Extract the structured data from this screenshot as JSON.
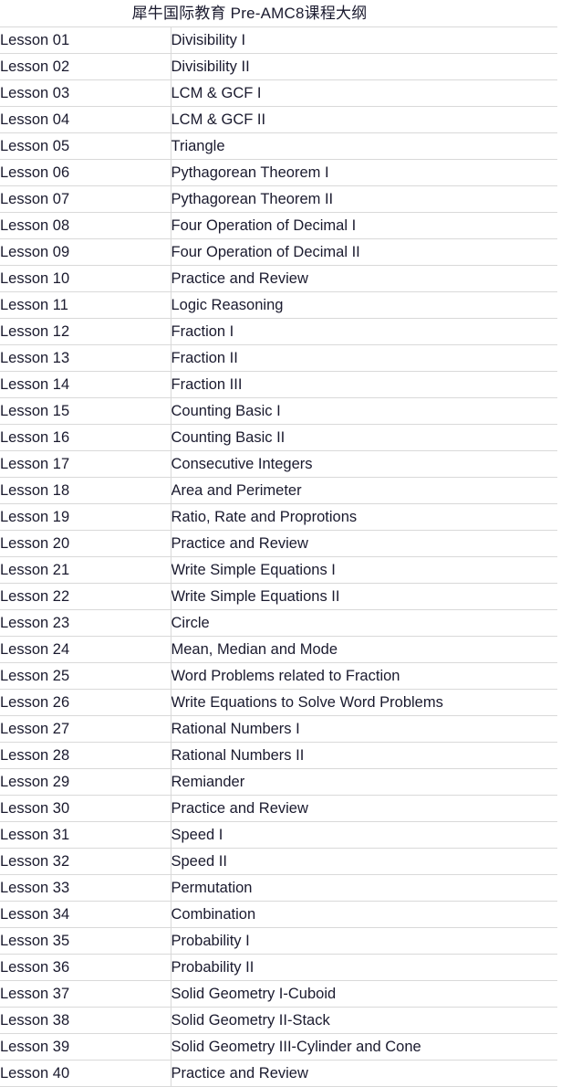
{
  "document": {
    "title": "犀牛国际教育 Pre-AMC8课程大纲",
    "border_color": "#d9d9d9",
    "text_color": "#1a1a2e",
    "background_color": "#ffffff"
  },
  "table": {
    "columns": [
      "lesson",
      "topic"
    ],
    "rows": [
      {
        "lesson": "Lesson 01",
        "topic": "Divisibility I"
      },
      {
        "lesson": "Lesson 02",
        "topic": "Divisibility II"
      },
      {
        "lesson": "Lesson 03",
        "topic": "LCM & GCF I"
      },
      {
        "lesson": "Lesson 04",
        "topic": "LCM & GCF II"
      },
      {
        "lesson": "Lesson 05",
        "topic": "Triangle"
      },
      {
        "lesson": "Lesson 06",
        "topic": "Pythagorean Theorem I"
      },
      {
        "lesson": "Lesson 07",
        "topic": "Pythagorean Theorem II"
      },
      {
        "lesson": "Lesson 08",
        "topic": "Four Operation of Decimal I"
      },
      {
        "lesson": "Lesson 09",
        "topic": "Four Operation of Decimal II"
      },
      {
        "lesson": "Lesson 10",
        "topic": "Practice and Review"
      },
      {
        "lesson": "Lesson 11",
        "topic": "Logic Reasoning"
      },
      {
        "lesson": "Lesson 12",
        "topic": "Fraction I"
      },
      {
        "lesson": "Lesson 13",
        "topic": "Fraction II"
      },
      {
        "lesson": "Lesson 14",
        "topic": "Fraction III"
      },
      {
        "lesson": "Lesson 15",
        "topic": "Counting Basic I"
      },
      {
        "lesson": "Lesson 16",
        "topic": "Counting Basic II"
      },
      {
        "lesson": "Lesson 17",
        "topic": "Consecutive Integers"
      },
      {
        "lesson": "Lesson 18",
        "topic": "Area and Perimeter"
      },
      {
        "lesson": "Lesson 19",
        "topic": "Ratio, Rate and Proprotions"
      },
      {
        "lesson": "Lesson 20",
        "topic": "Practice and Review"
      },
      {
        "lesson": "Lesson 21",
        "topic": "Write Simple Equations I"
      },
      {
        "lesson": "Lesson 22",
        "topic": "Write Simple Equations II"
      },
      {
        "lesson": "Lesson 23",
        "topic": "Circle"
      },
      {
        "lesson": "Lesson 24",
        "topic": "Mean, Median and Mode"
      },
      {
        "lesson": "Lesson 25",
        "topic": "Word Problems related to Fraction"
      },
      {
        "lesson": "Lesson 26",
        "topic": "Write Equations to Solve Word Problems"
      },
      {
        "lesson": "Lesson 27",
        "topic": "Rational Numbers I"
      },
      {
        "lesson": "Lesson 28",
        "topic": "Rational Numbers II"
      },
      {
        "lesson": "Lesson 29",
        "topic": "Remiander"
      },
      {
        "lesson": "Lesson 30",
        "topic": "Practice and Review"
      },
      {
        "lesson": "Lesson 31",
        "topic": "Speed I"
      },
      {
        "lesson": "Lesson 32",
        "topic": "Speed II"
      },
      {
        "lesson": "Lesson 33",
        "topic": "Permutation"
      },
      {
        "lesson": "Lesson 34",
        "topic": "Combination"
      },
      {
        "lesson": "Lesson 35",
        "topic": "Probability I"
      },
      {
        "lesson": "Lesson 36",
        "topic": "Probability II"
      },
      {
        "lesson": "Lesson 37",
        "topic": "Solid Geometry I-Cuboid"
      },
      {
        "lesson": "Lesson 38",
        "topic": "Solid Geometry II-Stack"
      },
      {
        "lesson": "Lesson 39",
        "topic": "Solid Geometry III-Cylinder and Cone"
      },
      {
        "lesson": "Lesson 40",
        "topic": "Practice and Review"
      }
    ]
  }
}
